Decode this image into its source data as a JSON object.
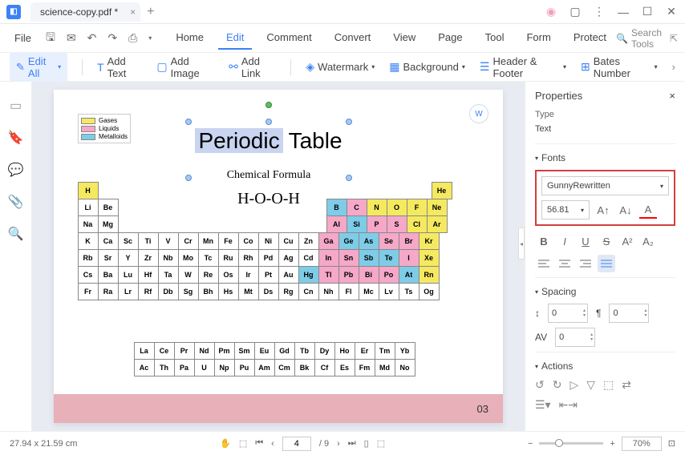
{
  "titlebar": {
    "filename": "science-copy.pdf *"
  },
  "menu": {
    "file": "File",
    "tabs": [
      "Home",
      "Edit",
      "Comment",
      "Convert",
      "View",
      "Page",
      "Tool",
      "Form",
      "Protect"
    ],
    "active_tab": "Edit",
    "search_placeholder": "Search Tools"
  },
  "toolbar": {
    "edit_all": "Edit All",
    "add_text": "Add Text",
    "add_image": "Add Image",
    "add_link": "Add Link",
    "watermark": "Watermark",
    "background": "Background",
    "header_footer": "Header & Footer",
    "bates": "Bates Number"
  },
  "document": {
    "title_word1": "Periodic",
    "title_word2": "Table",
    "subtitle": "Chemical Formula",
    "formula": "H-O-O-H",
    "legend": {
      "gases": "Gases",
      "liquids": "Liquids",
      "metalloids": "Metalloids"
    },
    "page_label": "03",
    "elements": {
      "r1": [
        "H",
        "He"
      ],
      "r2": [
        "Li",
        "Be",
        "B",
        "C",
        "N",
        "O",
        "F",
        "Ne"
      ],
      "r3": [
        "Na",
        "Mg",
        "Al",
        "Si",
        "P",
        "S",
        "Cl",
        "Ar"
      ],
      "r4": [
        "K",
        "Ca",
        "Sc",
        "Ti",
        "V",
        "Cr",
        "Mn",
        "Fe",
        "Co",
        "Ni",
        "Cu",
        "Zn",
        "Ga",
        "Ge",
        "As",
        "Se",
        "Br",
        "Kr"
      ],
      "r5": [
        "Rb",
        "Sr",
        "Y",
        "Zr",
        "Nb",
        "Mo",
        "Tc",
        "Ru",
        "Rh",
        "Pd",
        "Ag",
        "Cd",
        "In",
        "Sn",
        "Sb",
        "Te",
        "I",
        "Xe"
      ],
      "r6": [
        "Cs",
        "Ba",
        "Lu",
        "Hf",
        "Ta",
        "W",
        "Re",
        "Os",
        "Ir",
        "Pt",
        "Au",
        "Hg",
        "Tl",
        "Pb",
        "Bi",
        "Po",
        "At",
        "Rn"
      ],
      "r7": [
        "Fr",
        "Ra",
        "Lr",
        "Rf",
        "Db",
        "Sg",
        "Bh",
        "Hs",
        "Mt",
        "Ds",
        "Rg",
        "Cn",
        "Nh",
        "Fl",
        "Mc",
        "Lv",
        "Ts",
        "Og"
      ],
      "l1": [
        "La",
        "Ce",
        "Pr",
        "Nd",
        "Pm",
        "Sm",
        "Eu",
        "Gd",
        "Tb",
        "Dy",
        "Ho",
        "Er",
        "Tm",
        "Yb"
      ],
      "l2": [
        "Ac",
        "Th",
        "Pa",
        "U",
        "Np",
        "Pu",
        "Am",
        "Cm",
        "Bk",
        "Cf",
        "Es",
        "Fm",
        "Md",
        "No"
      ]
    }
  },
  "properties": {
    "title": "Properties",
    "type_label": "Type",
    "type_value": "Text",
    "fonts_label": "Fonts",
    "font_name": "GunnyRewritten",
    "font_size": "56.81",
    "spacing_label": "Spacing",
    "spacing_line": "0",
    "spacing_para": "0",
    "spacing_char": "0",
    "actions_label": "Actions"
  },
  "statusbar": {
    "dimensions": "27.94 x 21.59 cm",
    "page_current": "4",
    "page_total": "/ 9",
    "zoom": "70%"
  }
}
